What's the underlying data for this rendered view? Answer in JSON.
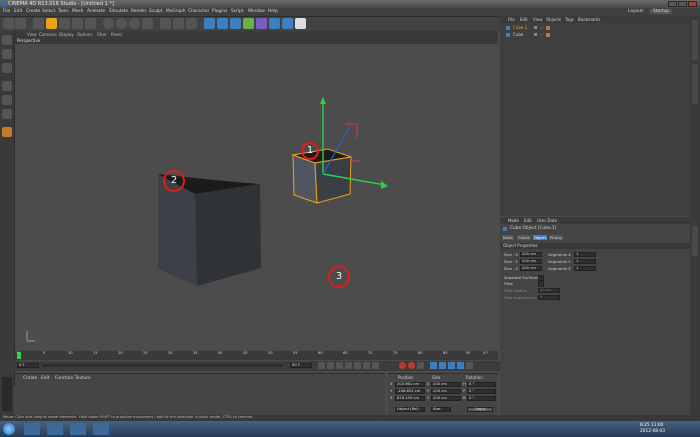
{
  "window": {
    "title": "CINEMA 4D R13.016 Studio - [Untitled 1 *]"
  },
  "menubar": [
    "File",
    "Edit",
    "Create",
    "Select",
    "Tools",
    "Mesh",
    "Animate",
    "Simulate",
    "Render",
    "Sculpt",
    "MoGraph",
    "Character",
    "Plugins",
    "Script",
    "Window",
    "Help"
  ],
  "layout": {
    "label": "Layout:",
    "value": "Startup"
  },
  "viewport": {
    "menu": [
      "View",
      "Cameras",
      "Display",
      "Options",
      "Filter",
      "Panel"
    ],
    "label": "Perspective",
    "annotations": [
      "1",
      "2",
      "3"
    ]
  },
  "timeline": {
    "ticks": [
      "0",
      "5",
      "10",
      "15",
      "20",
      "25",
      "30",
      "35",
      "40",
      "45",
      "50",
      "55",
      "60",
      "65",
      "70",
      "75",
      "80",
      "85",
      "90"
    ],
    "end_label": "0 F",
    "start_field": "0 F",
    "current_field": "0 F",
    "end_field": "90 F",
    "max_field": "90 F"
  },
  "materials": {
    "menu": [
      "Create",
      "Edit",
      "Function",
      "Texture"
    ]
  },
  "coordinates": {
    "headers": [
      "Position",
      "Size",
      "Rotation"
    ],
    "rows": [
      {
        "axis": "X",
        "pos": "203.961 cm",
        "size_axis": "X",
        "size": "200 cm",
        "rot_axis": "H",
        "rot": "0 °"
      },
      {
        "axis": "Y",
        "pos": "-106.852 cm",
        "size_axis": "Y",
        "size": "200 cm",
        "rot_axis": "P",
        "rot": "0 °"
      },
      {
        "axis": "Z",
        "pos": "876.155 cm",
        "size_axis": "Z",
        "size": "200 cm",
        "rot_axis": "B",
        "rot": "0 °"
      }
    ],
    "mode": "Object (Rel)",
    "size_mode": "Size",
    "apply": "Apply"
  },
  "object_manager": {
    "menu": [
      "File",
      "Edit",
      "View",
      "Objects",
      "Tags",
      "Bookmarks"
    ],
    "objects": [
      "Cube.1",
      "Cube"
    ]
  },
  "attribute_manager": {
    "menu": [
      "Mode",
      "Edit",
      "User Data"
    ],
    "object_title": "Cube Object [Cube.1]",
    "tabs": [
      "Basic",
      "Coord.",
      "Object",
      "Phong"
    ],
    "active_tab": "Object",
    "section": "Object Properties",
    "rows": [
      {
        "label": "Size . X",
        "value": "200 cm",
        "seg_label": "Segments X",
        "seg": "1"
      },
      {
        "label": "Size . Y",
        "value": "200 cm",
        "seg_label": "Segments Y",
        "seg": "1"
      },
      {
        "label": "Size . Z",
        "value": "200 cm",
        "seg_label": "Segments Z",
        "seg": "1"
      }
    ],
    "separate_surfaces": "Separate Surfaces",
    "fillet": "Fillet",
    "fillet_radius": {
      "label": "Fillet Radius",
      "value": "40 cm"
    },
    "fillet_subdivision": {
      "label": "Fillet Subdivision",
      "value": "5"
    }
  },
  "status": "Move: Click and drag to move elements. Hold down SHIFT to quantize movement / add to the selection in point mode, CTRL to remove.",
  "taskbar": {
    "time": "8:25 11:00",
    "date": "2012-08-03"
  },
  "colors": {
    "accent": "#e8a317",
    "selection": "#f0a020",
    "annotation": "#e21b1b"
  }
}
